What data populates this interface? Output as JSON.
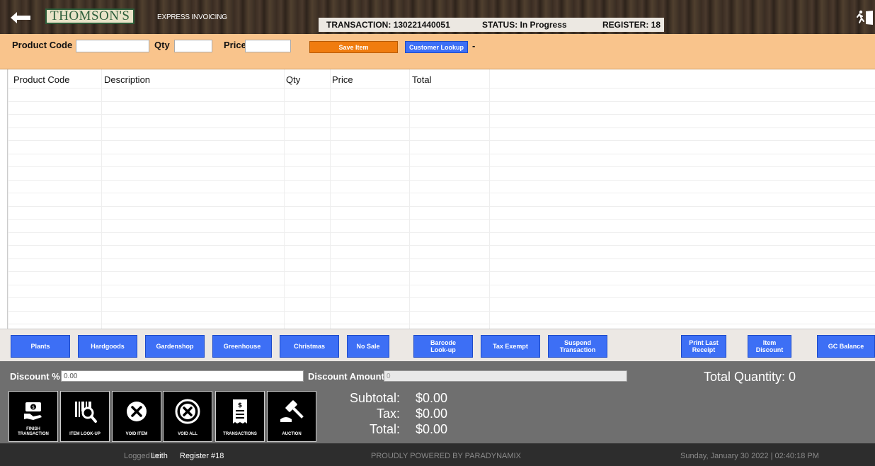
{
  "header": {
    "logo_text": "THOMSON'S",
    "app_title": "EXPRESS INVOICING",
    "transaction": "TRANSACTION: 130221440051",
    "status": "STATUS: In Progress",
    "register": "REGISTER: 18",
    "icons": [
      "back-arrow-icon",
      "exit-icon"
    ]
  },
  "entry": {
    "product_code_label": "Product Code",
    "product_code_value": "",
    "qty_label": "Qty",
    "qty_value": "",
    "price_label": "Price",
    "price_value": "",
    "save_item_label": "Save Item",
    "customer_lookup_label": "Customer Lookup",
    "customer_value": "-"
  },
  "table": {
    "columns": [
      "Product Code",
      "Description",
      "Qty",
      "Price",
      "Total"
    ],
    "rows": []
  },
  "categories": [
    {
      "label": "Plants"
    },
    {
      "label": "Hardgoods"
    },
    {
      "label": "Gardenshop"
    },
    {
      "label": "Greenhouse"
    },
    {
      "label": "Christmas"
    },
    {
      "label": "No Sale"
    },
    {
      "label": "Barcode\nLook-up"
    },
    {
      "label": "Tax Exempt"
    },
    {
      "label": "Suspend\nTransaction"
    },
    {
      "label": "Print Last\nReceipt"
    },
    {
      "label": "Item\nDiscount"
    },
    {
      "label": "GC Balance"
    }
  ],
  "discount": {
    "percent_label": "Discount %",
    "percent_value": "0.00",
    "amount_label": "Discount Amount",
    "amount_value": "0"
  },
  "total_quantity": "Total Quantity: 0",
  "actions": [
    {
      "label": "FINISH\nTRANSACTION",
      "icon": "cash-hand-icon"
    },
    {
      "label": "ITEM LOOK-UP",
      "icon": "barcode-search-icon"
    },
    {
      "label": "VOID ITEM",
      "icon": "x-circle-icon"
    },
    {
      "label": "VOID ALL",
      "icon": "x-circle-double-icon"
    },
    {
      "label": "TRANSACTIONS",
      "icon": "receipt-icon"
    },
    {
      "label": "AUCTION",
      "icon": "gavel-icon"
    }
  ],
  "totals": {
    "subtotal_label": "Subtotal:",
    "subtotal_value": "$0.00",
    "tax_label": "Tax:",
    "tax_value": "$0.00",
    "total_label": "Total:",
    "total_value": "$0.00"
  },
  "footer": {
    "logged_in_label": "Logged In:",
    "user": "Leith",
    "register": "Register #18",
    "powered_by": "PROUDLY POWERED BY PARADYNAMIX",
    "datetime": "Sunday, January 30 2022 | 02:40:18 PM"
  },
  "colors": {
    "entry_bar": "#f9c48c",
    "save_button": "#f07c0f",
    "blue_button": "#3d6ff5",
    "lower_panel": "#6f6f6f",
    "footer": "#2d2d2d"
  }
}
